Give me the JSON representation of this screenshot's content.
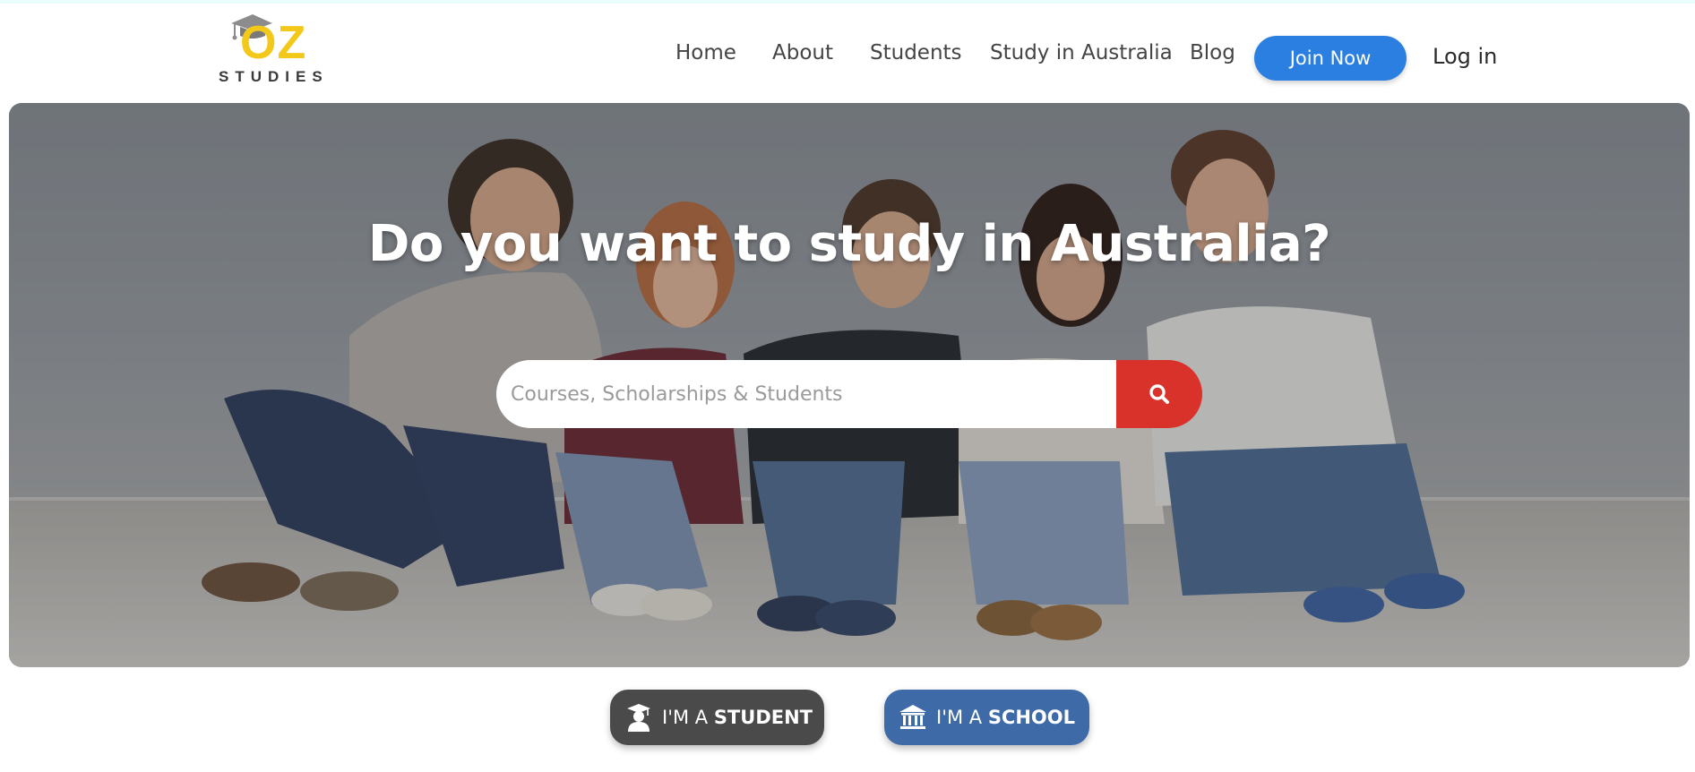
{
  "logo": {
    "wordmark": "OZ",
    "subtitle": "STUDIES",
    "icon": "graduation-cap-icon",
    "colors": {
      "oz": "#f2c81a",
      "cap": "#8c8c8c",
      "subtitle": "#3a3a3a"
    }
  },
  "nav": {
    "items": [
      {
        "label": "Home"
      },
      {
        "label": "About"
      },
      {
        "label": "Students"
      },
      {
        "label": "Study in Australia"
      },
      {
        "label": "Blog"
      }
    ],
    "join_label": "Join Now",
    "login_label": "Log in",
    "colors": {
      "join_bg": "#2a7fe0",
      "link": "#444444"
    }
  },
  "hero": {
    "title": "Do you want to study in Australia?",
    "search": {
      "placeholder": "Courses, Scholarships & Students",
      "value": "",
      "button_icon": "search-icon",
      "button_color": "#d9322b"
    }
  },
  "roles": {
    "student": {
      "prefix": "I'M A ",
      "bold": "STUDENT",
      "icon": "student-icon",
      "color": "#4a4a4a"
    },
    "school": {
      "prefix": "I'M A ",
      "bold": "SCHOOL",
      "icon": "school-building-icon",
      "color": "#3e6aa8"
    }
  }
}
